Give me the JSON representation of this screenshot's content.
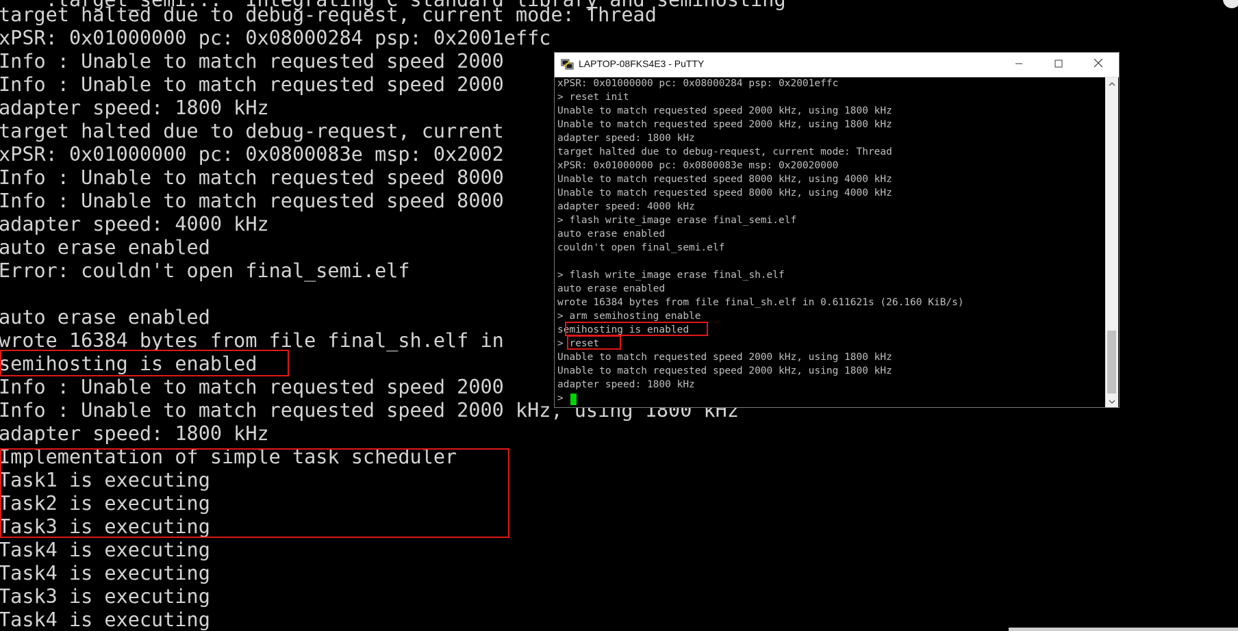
{
  "background_console": {
    "lines": [
      "    :target_semi...  Integrating C standard library and semihosting",
      "target halted due to debug-request, current mode: Thread",
      "xPSR: 0x01000000 pc: 0x08000284 psp: 0x2001effc",
      "Info : Unable to match requested speed 2000",
      "Info : Unable to match requested speed 2000",
      "adapter speed: 1800 kHz",
      "target halted due to debug-request, current",
      "xPSR: 0x01000000 pc: 0x0800083e msp: 0x2002",
      "Info : Unable to match requested speed 8000",
      "Info : Unable to match requested speed 8000",
      "adapter speed: 4000 kHz",
      "auto erase enabled",
      "Error: couldn't open final_semi.elf",
      "",
      "auto erase enabled",
      "wrote 16384 bytes from file final_sh.elf in",
      "semihosting is enabled",
      "Info : Unable to match requested speed 2000",
      "Info : Unable to match requested speed 2000 kHz, using 1800 kHz",
      "adapter speed: 1800 kHz",
      "Implementation of simple task scheduler",
      "Task1 is executing",
      "Task2 is executing",
      "Task3 is executing",
      "Task4 is executing",
      "Task4 is executing",
      "Task3 is executing",
      "Task4 is executing"
    ]
  },
  "putty": {
    "title": "LAPTOP-08FKS4E3 - PuTTY",
    "icon": "putty-icon",
    "buttons": {
      "minimize": "minimize-icon",
      "maximize": "maximize-icon",
      "close": "close-icon"
    },
    "terminal_lines": [
      "xPSR: 0x01000000 pc: 0x08000284 psp: 0x2001effc",
      "> reset init",
      "Unable to match requested speed 2000 kHz, using 1800 kHz",
      "Unable to match requested speed 2000 kHz, using 1800 kHz",
      "adapter speed: 1800 kHz",
      "target halted due to debug-request, current mode: Thread",
      "xPSR: 0x01000000 pc: 0x0800083e msp: 0x20020000",
      "Unable to match requested speed 8000 kHz, using 4000 kHz",
      "Unable to match requested speed 8000 kHz, using 4000 kHz",
      "adapter speed: 4000 kHz",
      "> flash write_image erase final_semi.elf",
      "auto erase enabled",
      "couldn't open final_semi.elf",
      "",
      "> flash write_image erase final_sh.elf",
      "auto erase enabled",
      "wrote 16384 bytes from file final_sh.elf in 0.611621s (26.160 KiB/s)",
      "> arm semihosting enable",
      "semihosting is enabled",
      "> reset",
      "Unable to match requested speed 2000 kHz, using 1800 kHz",
      "Unable to match requested speed 2000 kHz, using 1800 kHz",
      "adapter speed: 1800 kHz",
      "> "
    ]
  },
  "colors": {
    "highlight_box": "#e01818",
    "cursor": "#00d400",
    "terminal_text": "#c0c0c0",
    "background_text": "#d4d4d4"
  }
}
